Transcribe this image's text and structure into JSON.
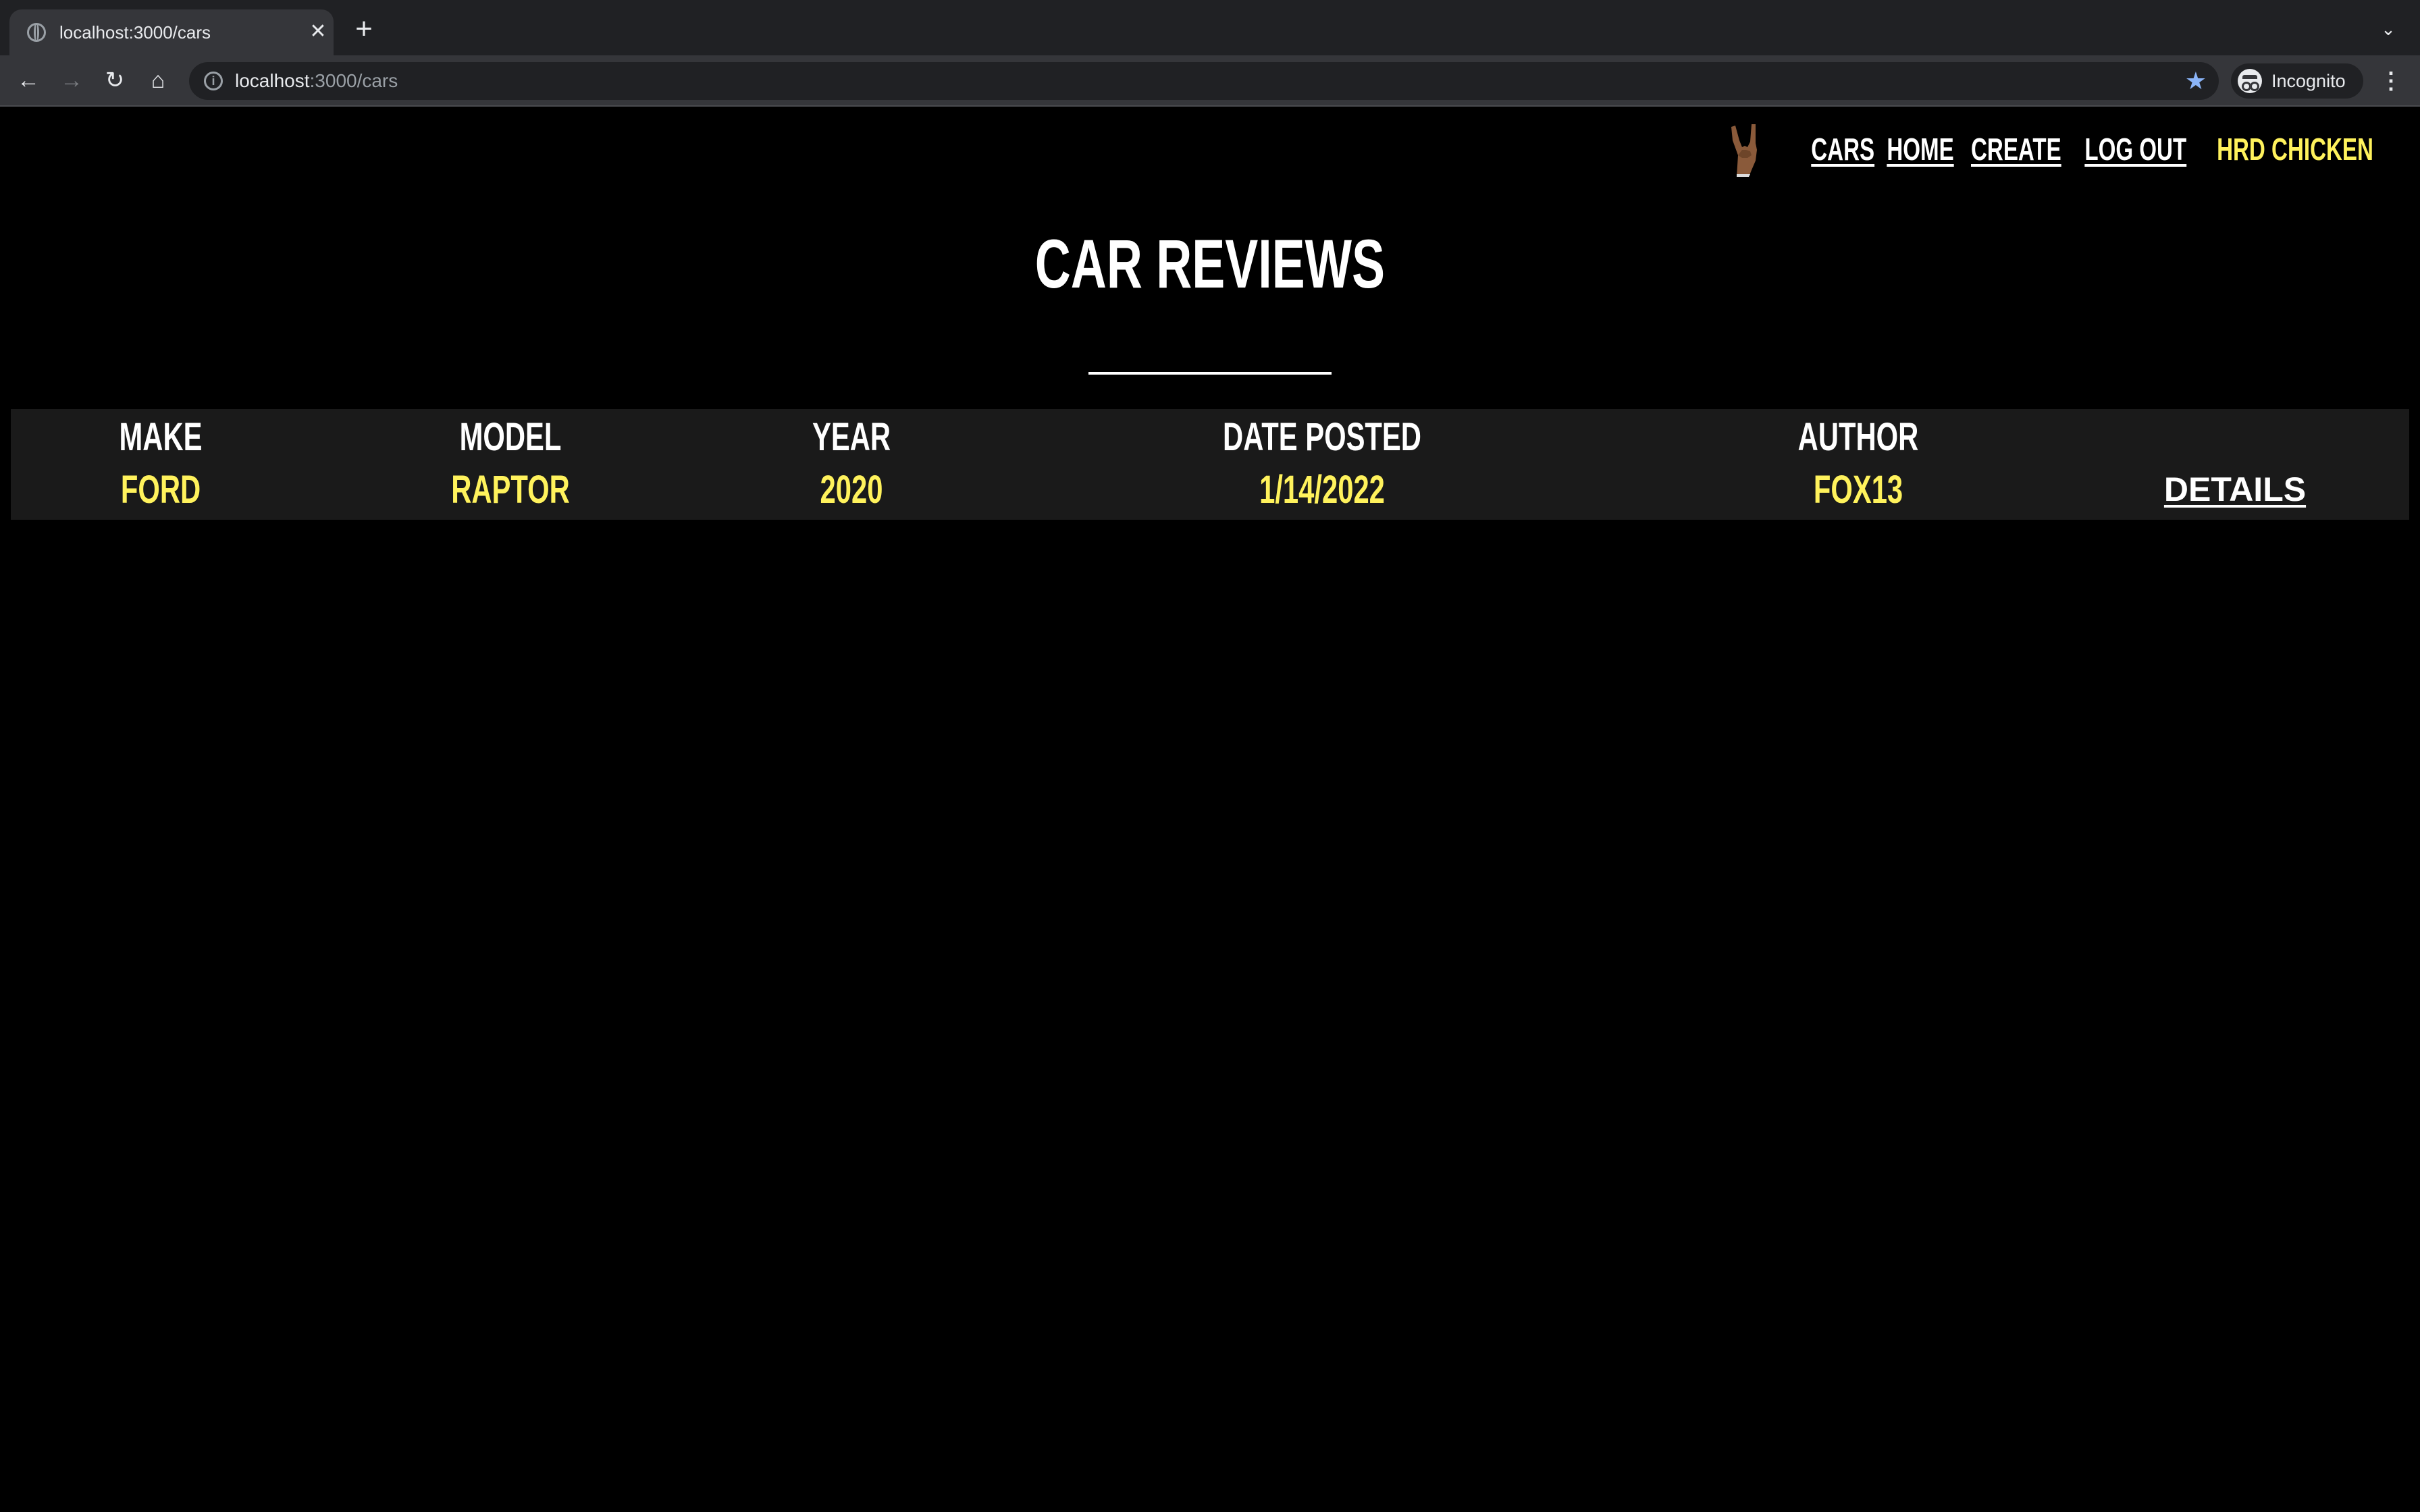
{
  "browser": {
    "tab_title": "localhost:3000/cars",
    "url_host": "localhost",
    "url_path": ":3000/cars",
    "profile_label": "Incognito"
  },
  "nav": {
    "logo_icon": "rock-hand-icon",
    "links": [
      "CARS",
      "HOME",
      "CREATE",
      "LOG OUT"
    ],
    "username": "HRD CHICKEN",
    "accent_color": "#fff25c"
  },
  "page": {
    "heading": "CAR REVIEWS"
  },
  "reviews": {
    "columns": [
      "MAKE",
      "MODEL",
      "YEAR",
      "DATE POSTED",
      "AUTHOR"
    ],
    "rows": [
      {
        "make": "FORD",
        "model": "RAPTOR",
        "year": "2020",
        "date_posted": "1/14/2022",
        "author": "FOX13",
        "action": "DETAILS"
      }
    ]
  }
}
